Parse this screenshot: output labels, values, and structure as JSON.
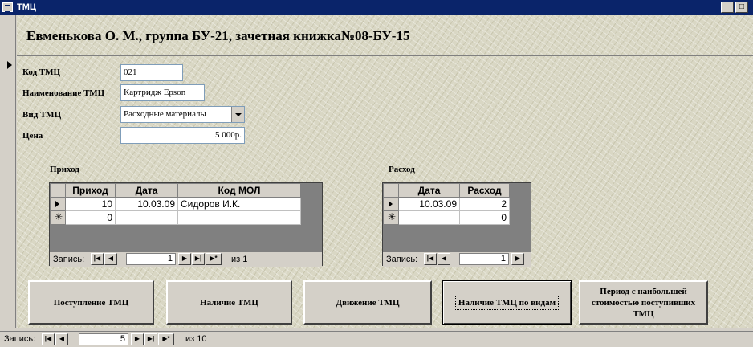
{
  "window": {
    "title": "ТМЦ",
    "buttons": {
      "minimize": "_",
      "maximize": "□",
      "close": "×"
    }
  },
  "form": {
    "header": "Евменькова О. М., группа БУ-21, зачетная книжка№08-БУ-15",
    "fields": {
      "code_label": "Код ТМЦ",
      "code_value": "021",
      "name_label": "Наименование ТМЦ",
      "name_value": "Картридж Epson",
      "type_label": "Вид ТМЦ",
      "type_value": "Расходные материалы",
      "price_label": "Цена",
      "price_value": "5 000р."
    }
  },
  "income": {
    "title": "Приход",
    "columns": [
      "Приход",
      "Дата",
      "Код МОЛ"
    ],
    "rows": [
      {
        "qty": "10",
        "date": "10.03.09",
        "mol": "Сидоров И.К."
      },
      {
        "qty": "0",
        "date": "",
        "mol": ""
      }
    ],
    "nav": {
      "label": "Запись:",
      "current": "1",
      "of": "из 1"
    }
  },
  "expense": {
    "title": "Расход",
    "columns": [
      "Дата",
      "Расход"
    ],
    "rows": [
      {
        "date": "10.03.09",
        "qty": "2"
      },
      {
        "date": "",
        "qty": "0"
      }
    ],
    "nav": {
      "label": "Запись:",
      "current": "1"
    }
  },
  "buttons": {
    "receipt": "Поступление ТМЦ",
    "availability": "Наличие ТМЦ",
    "movement": "Движение ТМЦ",
    "availability_by_type": "Наличие ТМЦ по видам",
    "period_max": "Период с наибольшей стоимостью поступивших ТМЦ"
  },
  "main_nav": {
    "label": "Запись:",
    "current": "5",
    "of": "из 10"
  },
  "nav_glyphs": {
    "first": "|◀",
    "prev": "◀",
    "next": "▶",
    "last": "▶|",
    "new": "▶*"
  }
}
